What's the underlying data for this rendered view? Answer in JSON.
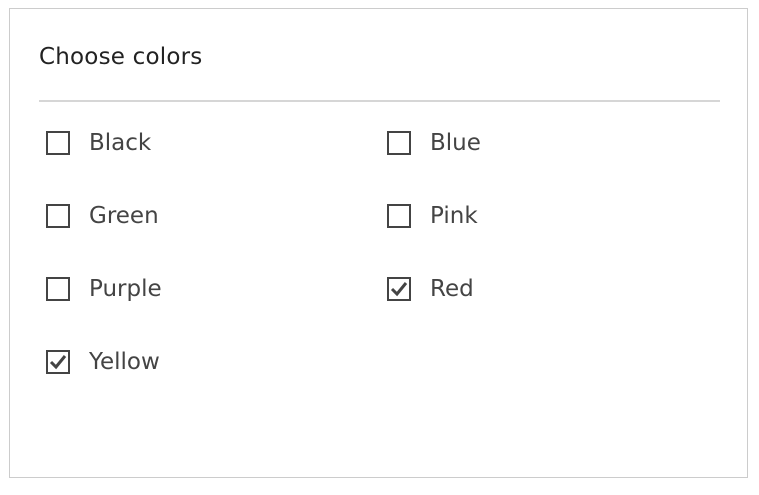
{
  "title": "Choose colors",
  "options": [
    {
      "label": "Black",
      "checked": false
    },
    {
      "label": "Blue",
      "checked": false
    },
    {
      "label": "Green",
      "checked": false
    },
    {
      "label": "Pink",
      "checked": false
    },
    {
      "label": "Purple",
      "checked": false
    },
    {
      "label": "Red",
      "checked": true
    },
    {
      "label": "Yellow",
      "checked": true
    }
  ]
}
